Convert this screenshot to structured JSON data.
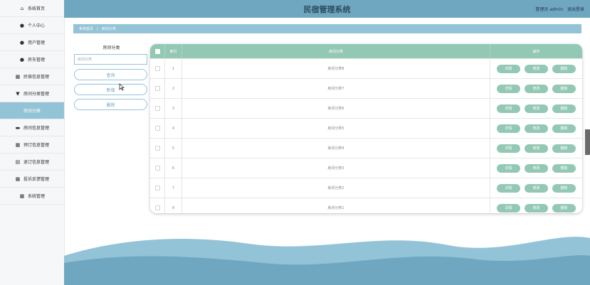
{
  "header": {
    "title": "民宿管理系统",
    "user_label": "管理员 admin",
    "logout": "退出登录"
  },
  "sidebar": {
    "items": [
      {
        "label": "系统首页",
        "icon": "home-icon",
        "glyph": "⌂",
        "active": false
      },
      {
        "label": "个人中心",
        "icon": "person-icon",
        "glyph": "●",
        "active": false
      },
      {
        "label": "用户管理",
        "icon": "person-icon",
        "glyph": "●",
        "active": false
      },
      {
        "label": "房东管理",
        "icon": "person-icon",
        "glyph": "●",
        "active": false
      },
      {
        "label": "民宿信息管理",
        "icon": "grid-icon",
        "glyph": "▦",
        "active": false
      },
      {
        "label": "房间分类管理",
        "icon": "trophy-icon",
        "glyph": "▼",
        "active": false
      },
      {
        "label": "房间分类",
        "icon": "",
        "glyph": "",
        "active": true
      },
      {
        "label": "房间信息管理",
        "icon": "briefcase-icon",
        "glyph": "▬",
        "active": false
      },
      {
        "label": "预订信息管理",
        "icon": "grid-icon",
        "glyph": "▦",
        "active": false
      },
      {
        "label": "退订信息管理",
        "icon": "document-icon",
        "glyph": "▤",
        "active": false
      },
      {
        "label": "投诉反馈管理",
        "icon": "grid-icon",
        "glyph": "▦",
        "active": false
      },
      {
        "label": "系统管理",
        "icon": "grid-icon",
        "glyph": "▦",
        "active": false
      }
    ]
  },
  "breadcrumb": {
    "home": "系统首页",
    "separator": "|",
    "current": "房间分类"
  },
  "search": {
    "label": "房间分类",
    "placeholder": "房间分类",
    "query_button": "查询",
    "add_button": "新增",
    "delete_button": "删除"
  },
  "table": {
    "headers": {
      "index": "索引",
      "category": "房间分类",
      "actions": "操作"
    },
    "rows": [
      {
        "index": "1",
        "category": "房间分类8"
      },
      {
        "index": "2",
        "category": "房间分类7"
      },
      {
        "index": "3",
        "category": "房间分类6"
      },
      {
        "index": "4",
        "category": "房间分类5"
      },
      {
        "index": "5",
        "category": "房间分类4"
      },
      {
        "index": "6",
        "category": "房间分类3"
      },
      {
        "index": "7",
        "category": "房间分类2"
      },
      {
        "index": "8",
        "category": "房间分类1"
      }
    ],
    "actions": {
      "detail": "详情",
      "edit": "修改",
      "delete": "删除"
    }
  },
  "colors": {
    "header": "#6fa7c0",
    "accent": "#93c3d6",
    "table_header": "#93c8b4",
    "wave_dark": "#6fa7c0",
    "wave_light": "#93c3d6"
  }
}
